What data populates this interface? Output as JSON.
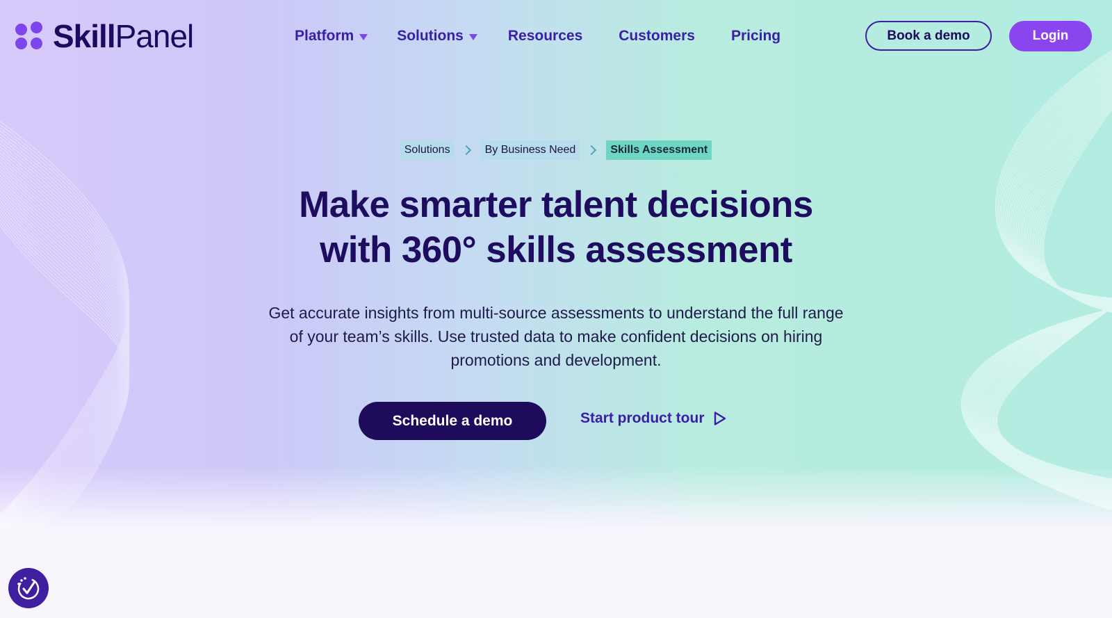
{
  "brand": {
    "name_bold": "Skill",
    "name_regular": "Panel",
    "logo_icon": "four-dots-logo",
    "accent_color": "#8a45ee",
    "dark_color": "#1f0b5b"
  },
  "nav": {
    "items": [
      {
        "label": "Platform",
        "has_dropdown": true
      },
      {
        "label": "Solutions",
        "has_dropdown": true
      },
      {
        "label": "Resources",
        "has_dropdown": false
      },
      {
        "label": "Customers",
        "has_dropdown": false
      },
      {
        "label": "Pricing",
        "has_dropdown": false
      }
    ],
    "book_demo_label": "Book a demo",
    "login_label": "Login"
  },
  "breadcrumb": {
    "items": [
      "Solutions",
      "By Business Need",
      "Skills Assessment"
    ]
  },
  "hero": {
    "headline_line1": "Make smarter talent decisions",
    "headline_line2": "with 360° skills assessment",
    "subtext": "Get accurate insights from multi-source assessments to understand the full range of your team’s skills. Use trusted data to make confident decisions on hiring promotions and development.",
    "primary_cta": "Schedule a demo",
    "secondary_cta": "Start product tour",
    "secondary_cta_icon": "play-outline-icon"
  },
  "accessibility_widget": {
    "icon": "accessibility-check-icon"
  }
}
